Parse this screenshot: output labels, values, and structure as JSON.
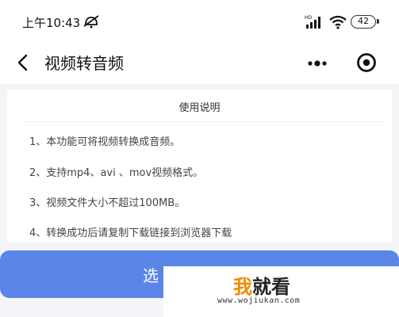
{
  "status_bar": {
    "time": "上午10:43",
    "battery": "42",
    "signal_label": "HD"
  },
  "nav": {
    "title": "视频转音频"
  },
  "instructions": {
    "title": "使用说明",
    "items": [
      "1、本功能可将视频转换成音频。",
      "2、支持mp4、avi 、mov视频格式。",
      "3、视频文件大小不超过100MB。",
      "4、转换成功后请复制下载链接到浏览器下载"
    ]
  },
  "action": {
    "select_label": "选"
  },
  "watermark": {
    "brand_accent": "我",
    "brand_rest": "就看",
    "url": "www.wojiukan.com"
  },
  "colors": {
    "accent": "#5a86e9",
    "watermark_accent": "#f08a00"
  }
}
